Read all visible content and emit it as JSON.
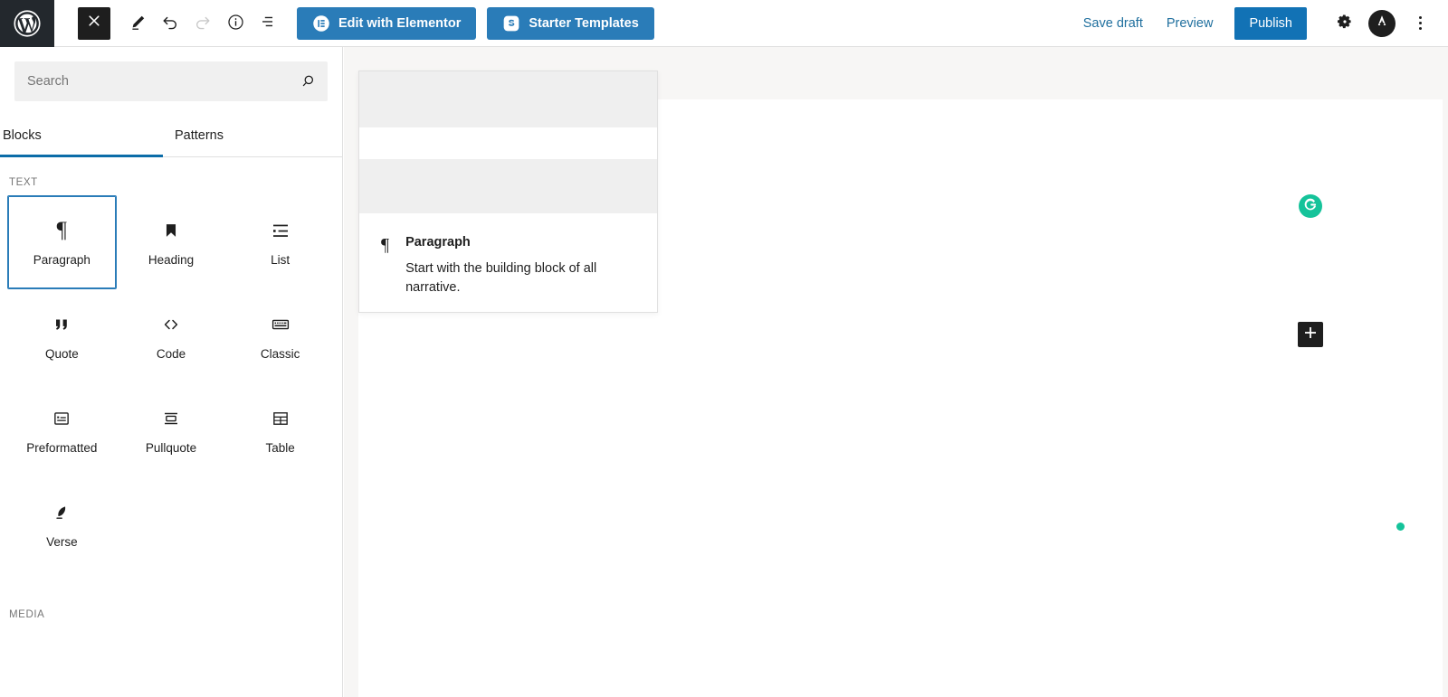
{
  "topbar": {
    "logo_icon": "wordpress-logo",
    "close_icon": "close-x-icon",
    "edit_icon": "pencil-edit-icon",
    "undo_icon": "undo-arrow-icon",
    "redo_icon": "redo-arrow-icon",
    "info_icon": "info-circle-icon",
    "outline_icon": "list-view-outline-icon",
    "elementor": {
      "label": "Edit with Elementor",
      "icon": "elementor-logo-icon"
    },
    "starter_templates": {
      "label": "Starter Templates",
      "icon": "starter-templates-logo-icon"
    },
    "save_draft": "Save draft",
    "preview": "Preview",
    "publish": "Publish",
    "settings_icon": "gear-settings-icon",
    "avatar_icon": "astra-avatar-icon",
    "kebab_icon": "more-options-kebab-icon",
    "colors": {
      "accent_blue": "#2a7cb8",
      "publish_blue": "#1272b5",
      "link_blue": "#1f6f9e",
      "dark": "#1e1e1e",
      "logo_bg": "#23282d"
    }
  },
  "sidebar": {
    "search": {
      "value": "",
      "placeholder": "Search",
      "icon": "search-magnifier-icon"
    },
    "tabs": [
      {
        "label": "Blocks",
        "active": true
      },
      {
        "label": "Patterns",
        "active": false
      }
    ],
    "categories": [
      {
        "label": "TEXT",
        "blocks": [
          {
            "label": "Paragraph",
            "icon": "paragraph-pilcrow-icon",
            "selected": true
          },
          {
            "label": "Heading",
            "icon": "heading-bookmark-icon",
            "selected": false
          },
          {
            "label": "List",
            "icon": "list-bullet-icon",
            "selected": false
          },
          {
            "label": "Quote",
            "icon": "quote-marks-icon",
            "selected": false
          },
          {
            "label": "Code",
            "icon": "code-angle-brackets-icon",
            "selected": false
          },
          {
            "label": "Classic",
            "icon": "classic-keyboard-icon",
            "selected": false
          },
          {
            "label": "Preformatted",
            "icon": "preformatted-box-icon",
            "selected": false
          },
          {
            "label": "Pullquote",
            "icon": "pullquote-lines-icon",
            "selected": false
          },
          {
            "label": "Table",
            "icon": "table-grid-icon",
            "selected": false
          },
          {
            "label": "Verse",
            "icon": "verse-feather-icon",
            "selected": false
          }
        ]
      },
      {
        "label": "MEDIA",
        "blocks": []
      }
    ]
  },
  "canvas": {
    "preview_popover": {
      "icon": "paragraph-pilcrow-icon",
      "title": "Paragraph",
      "description": "Start with the building block of all narrative."
    },
    "grammarly_icon": "grammarly-logo-icon",
    "add_block_icon": "add-block-plus-icon",
    "status_dot": "grammarly-status-dot"
  }
}
